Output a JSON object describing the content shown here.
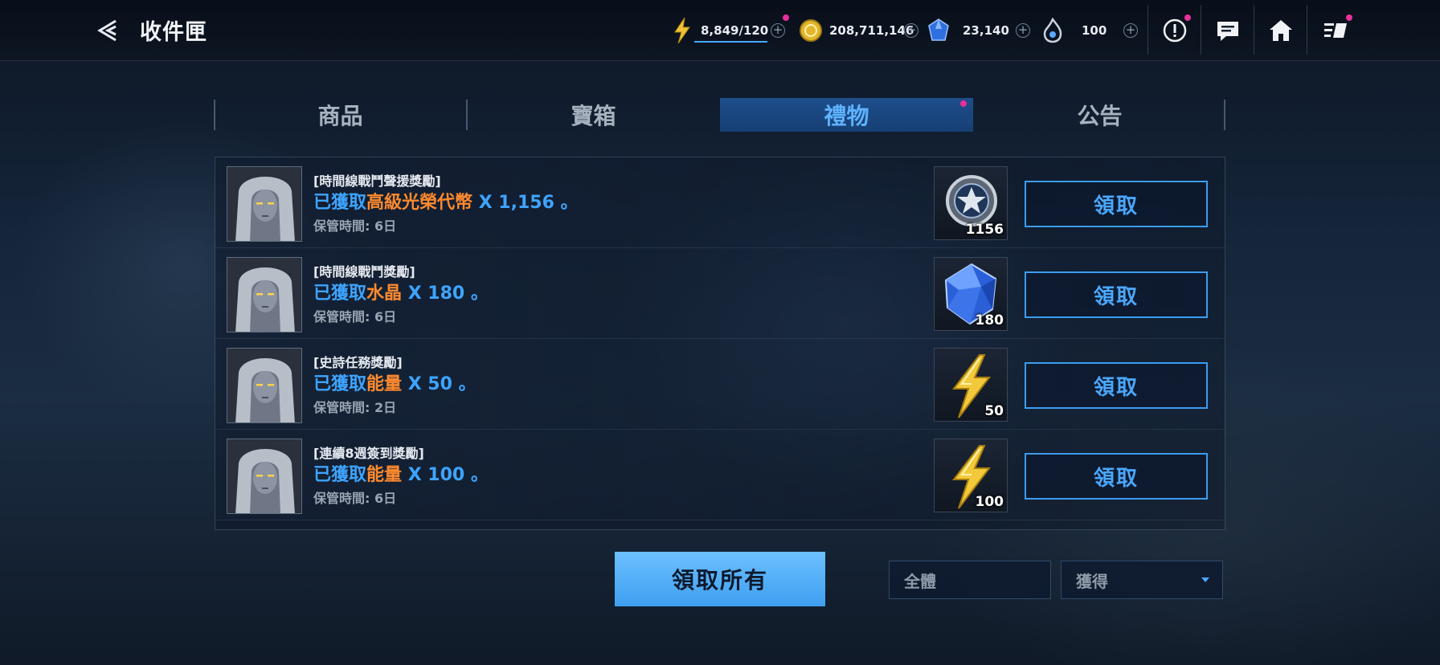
{
  "header": {
    "title": "收件匣",
    "resources": [
      {
        "icon": "energy-bolt-icon",
        "value": "8,849/120"
      },
      {
        "icon": "gold-coin-icon",
        "value": "208,711,146"
      },
      {
        "icon": "crystal-icon",
        "value": "23,140"
      },
      {
        "icon": "flame-token-icon",
        "value": "100"
      }
    ]
  },
  "tabs": [
    {
      "label": "商品",
      "active": false
    },
    {
      "label": "寶箱",
      "active": false
    },
    {
      "label": "禮物",
      "active": true
    },
    {
      "label": "公告",
      "active": false
    }
  ],
  "items": [
    {
      "title": "[時間線戰鬥聲援獎勵]",
      "prefix": "已獲取",
      "item_name": "高級光榮代幣",
      "suffix": " X 1,156 。",
      "keep": "保管時間: 6日",
      "icon": "glory-token-icon",
      "count": "1156",
      "claim_label": "領取"
    },
    {
      "title": "[時間線戰鬥獎勵]",
      "prefix": "已獲取",
      "item_name": "水晶",
      "suffix": " X 180 。",
      "keep": "保管時間: 6日",
      "icon": "crystal-icon",
      "count": "180",
      "claim_label": "領取"
    },
    {
      "title": "[史詩任務獎勵]",
      "prefix": "已獲取",
      "item_name": "能量",
      "suffix": " X 50 。",
      "keep": "保管時間: 2日",
      "icon": "energy-bolt-icon",
      "count": "50",
      "claim_label": "領取"
    },
    {
      "title": "[連續8週簽到獎勵]",
      "prefix": "已獲取",
      "item_name": "能量",
      "suffix": " X 100 。",
      "keep": "保管時間: 6日",
      "icon": "energy-bolt-icon",
      "count": "100",
      "claim_label": "領取"
    }
  ],
  "footer": {
    "claim_all_label": "領取所有",
    "filter_value": "全體",
    "sort_value": "獲得"
  },
  "colors": {
    "accent_blue": "#3ea4ff",
    "highlight_orange": "#ff8a2e",
    "notification_dot": "#e8309a"
  }
}
